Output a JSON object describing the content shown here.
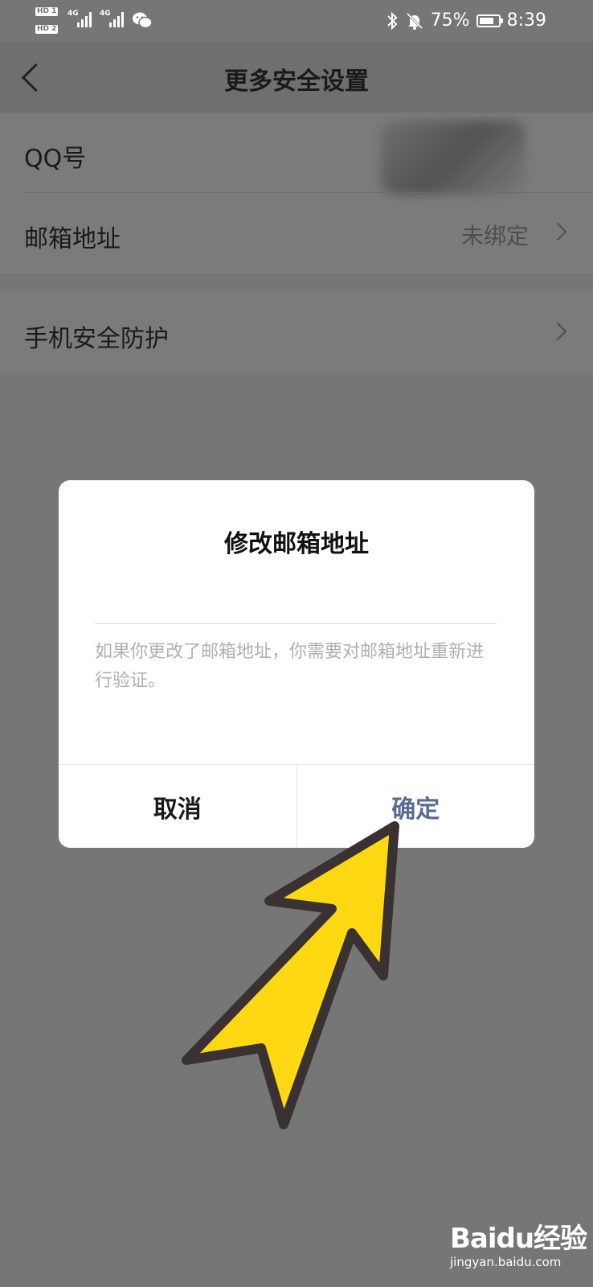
{
  "status_bar": {
    "sim1": "HD 1",
    "sim2": "HD 2",
    "net1": "4G",
    "net2": "4G",
    "battery_percent_text": "75%",
    "battery_level": 0.75,
    "time": "8:39",
    "icons": [
      "bluetooth-icon",
      "mute-bell-icon",
      "battery-icon",
      "wechat-icon"
    ]
  },
  "header": {
    "back_icon": "chevron-left-icon",
    "title": "更多安全设置"
  },
  "list": {
    "qq_label": "QQ号",
    "email_label": "邮箱地址",
    "email_value": "未绑定",
    "phone_protect_label": "手机安全防护"
  },
  "dialog": {
    "title": "修改邮箱地址",
    "input_value": "",
    "input_placeholder": "",
    "hint": "如果你更改了邮箱地址，你需要对邮箱地址重新进行验证。",
    "cancel_label": "取消",
    "confirm_label": "确定"
  },
  "watermark": {
    "brand": "Baidu经验",
    "site": "jingyan.baidu.com"
  },
  "colors": {
    "overlay_bg": "#767676",
    "confirm_text": "#576b95",
    "arrow_fill": "#FFD814",
    "arrow_stroke": "#3a3232"
  }
}
